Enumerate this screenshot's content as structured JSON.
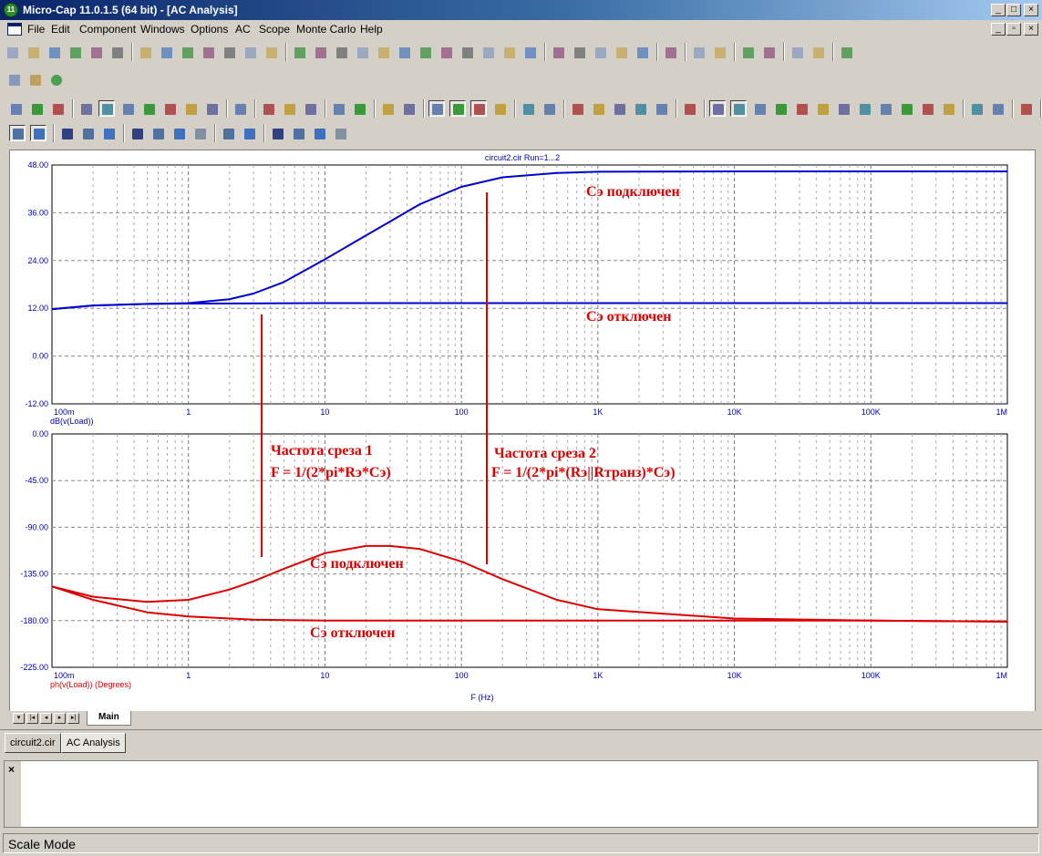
{
  "window": {
    "title": "Micro-Cap 11.0.1.5 (64 bit) - [AC Analysis]",
    "app_icon": "micro-cap-logo"
  },
  "menu": [
    "File",
    "Edit",
    "Component",
    "Windows",
    "Options",
    "AC",
    "Scope",
    "Monte Carlo",
    "Help"
  ],
  "plot": {
    "header": "circuit2.cir Run=1...2",
    "top_pane": {
      "label": "dB(v(Load))",
      "y_ticks": [
        "48.00",
        "36.00",
        "24.00",
        "12.00",
        "0.00",
        "-12.00"
      ],
      "x_ticks": [
        "100m",
        "1",
        "10",
        "100",
        "1K",
        "10K",
        "100K",
        "1M"
      ]
    },
    "bottom_pane": {
      "label": "ph(v(Load)) (Degrees)",
      "y_ticks": [
        "0.00",
        "-45.00",
        "-90.00",
        "-135.00",
        "-180.00",
        "-225.00"
      ],
      "x_ticks": [
        "100m",
        "1",
        "10",
        "100",
        "1K",
        "10K",
        "100K",
        "1M"
      ]
    },
    "xlabel": "F (Hz)",
    "annotations": {
      "top_connected": "Сэ подключен",
      "top_disconnected": "Сэ отключен",
      "cutoff1_title": "Частота среза 1",
      "cutoff1_formula": "F = 1/(2*pi*Rэ*Cэ)",
      "cutoff2_title": "Частота среза 2",
      "cutoff2_formula": "F = 1/(2*pi*(Rэ||Rтранз)*Cэ)",
      "bottom_connected": "Сэ подключен",
      "bottom_disconnected": "Сэ отключен"
    },
    "colors": {
      "magnitude": "#0000cc",
      "phase": "#dd0000",
      "grid": "#999999",
      "annotation": "#dd0000"
    }
  },
  "chart_data": [
    {
      "type": "line",
      "xscale": "log",
      "xlim": [
        0.1,
        1000000
      ],
      "ylim": [
        -12,
        48
      ],
      "xlabel": "",
      "ylabel": "dB(v(Load))",
      "x_ticks": [
        "100m",
        "1",
        "10",
        "100",
        "1K",
        "10K",
        "100K",
        "1M"
      ],
      "y_ticks": [
        "48.00",
        "36.00",
        "24.00",
        "12.00",
        "0.00",
        "-12.00"
      ],
      "grid": true,
      "series": [
        {
          "x": [
            0.1,
            0.2,
            0.5,
            1,
            2,
            3,
            5,
            10,
            20,
            50,
            100,
            200,
            500,
            1000,
            10000,
            100000,
            1000000
          ],
          "y": [
            11.8,
            12.7,
            13.1,
            13.3,
            14.3,
            15.7,
            18.6,
            24.3,
            30.3,
            38.2,
            42.5,
            44.9,
            46.0,
            46.3,
            46.4,
            46.4,
            46.4
          ]
        },
        {
          "x": [
            0.1,
            0.2,
            0.5,
            1,
            10,
            100,
            1000,
            10000,
            100000,
            1000000
          ],
          "y": [
            11.8,
            12.7,
            13.1,
            13.2,
            13.3,
            13.3,
            13.3,
            13.3,
            13.3,
            13.3
          ]
        }
      ]
    },
    {
      "type": "line",
      "xscale": "log",
      "xlim": [
        0.1,
        1000000
      ],
      "ylim": [
        -225,
        0
      ],
      "xlabel": "F (Hz)",
      "ylabel": "ph(v(Load)) (Degrees)",
      "x_ticks": [
        "100m",
        "1",
        "10",
        "100",
        "1K",
        "10K",
        "100K",
        "1M"
      ],
      "y_ticks": [
        "0.00",
        "-45.00",
        "-90.00",
        "-135.00",
        "-180.00",
        "-225.00"
      ],
      "grid": true,
      "series": [
        {
          "x": [
            0.1,
            0.2,
            0.5,
            1,
            2,
            3,
            5,
            10,
            20,
            30,
            50,
            100,
            200,
            500,
            1000,
            10000,
            100000,
            1000000
          ],
          "y": [
            -147,
            -157,
            -162,
            -160,
            -150,
            -142,
            -130,
            -115,
            -108,
            -108,
            -111,
            -123,
            -140,
            -160,
            -169,
            -178,
            -180,
            -181
          ]
        },
        {
          "x": [
            0.1,
            0.2,
            0.5,
            1,
            3,
            10,
            100,
            1000,
            10000,
            100000,
            1000000
          ],
          "y": [
            -147,
            -160,
            -172,
            -176,
            -179,
            -180,
            -180,
            -180,
            -180,
            -180,
            -181
          ]
        }
      ]
    }
  ],
  "tabs": {
    "main": "Main"
  },
  "doc_tabs": [
    "circuit2.cir",
    "AC Analysis"
  ],
  "output": {
    "close": "×"
  },
  "status": "Scale Mode"
}
